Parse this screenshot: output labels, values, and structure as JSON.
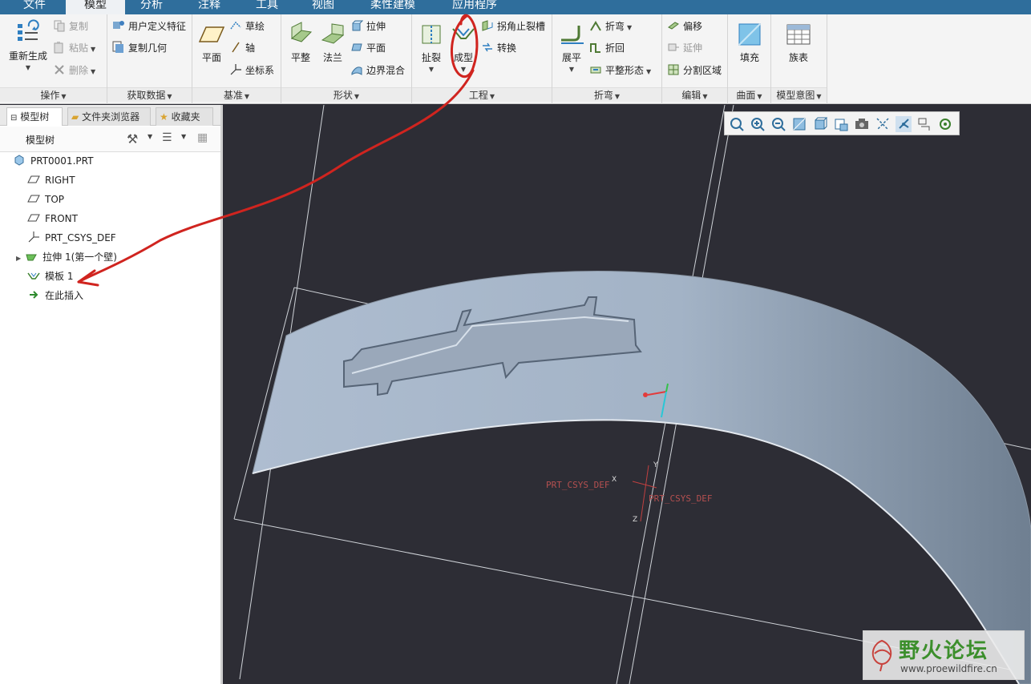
{
  "tabs": [
    "文件",
    "模型",
    "分析",
    "注释",
    "工具",
    "视图",
    "柔性建模",
    "应用程序"
  ],
  "active_tab": "模型",
  "ribbon": {
    "operations": {
      "regenerate": "重新生成",
      "copy": "复制",
      "paste": "粘贴",
      "delete": "删除",
      "label": "操作"
    },
    "get_data": {
      "udf": "用户定义特征",
      "copy_geom": "复制几何",
      "label": "获取数据"
    },
    "datum": {
      "plane": "平面",
      "sketch": "草绘",
      "axis": "轴",
      "csys": "坐标系",
      "label": "基准"
    },
    "shapes": {
      "flat": "平整",
      "flange": "法兰",
      "extrude": "拉伸",
      "planar": "平面",
      "boundary_blend": "边界混合",
      "label": "形状"
    },
    "engineering": {
      "rip": "扯裂",
      "form": "成型",
      "corner_relief": "拐角止裂槽",
      "convert": "转换",
      "label": "工程"
    },
    "bends": {
      "unbend": "展平",
      "bend": "折弯",
      "bend_back": "折回",
      "flatten_form": "平整形态",
      "label": "折弯"
    },
    "editing": {
      "offset": "偏移",
      "extend": "延伸",
      "split_area": "分割区域",
      "label": "编辑"
    },
    "surfaces": {
      "fill": "填充",
      "label": "曲面"
    },
    "model_intent": {
      "family_table": "族表",
      "label": "模型意图"
    }
  },
  "panel": {
    "tabs": [
      "模型树",
      "文件夹浏览器",
      "收藏夹"
    ],
    "tree_header": "模型树",
    "items": [
      "PRT0001.PRT",
      "RIGHT",
      "TOP",
      "FRONT",
      "PRT_CSYS_DEF",
      "拉伸 1(第一个壁)",
      "模板 1",
      "在此插入"
    ]
  },
  "viewport": {
    "csys_label_1": "PRT_CSYS_DEF",
    "csys_label_2": "PRT_CSYS_DEF",
    "axis_x": "X",
    "axis_y": "Y",
    "axis_z": "Z"
  },
  "watermark": {
    "title": "野火论坛",
    "url": "www.proewildfire.cn"
  },
  "colors": {
    "tabbar": "#2f6e9c",
    "viewport_bg": "#2d2d35",
    "part": "#a9b7c8",
    "annotation": "#d0241f"
  }
}
